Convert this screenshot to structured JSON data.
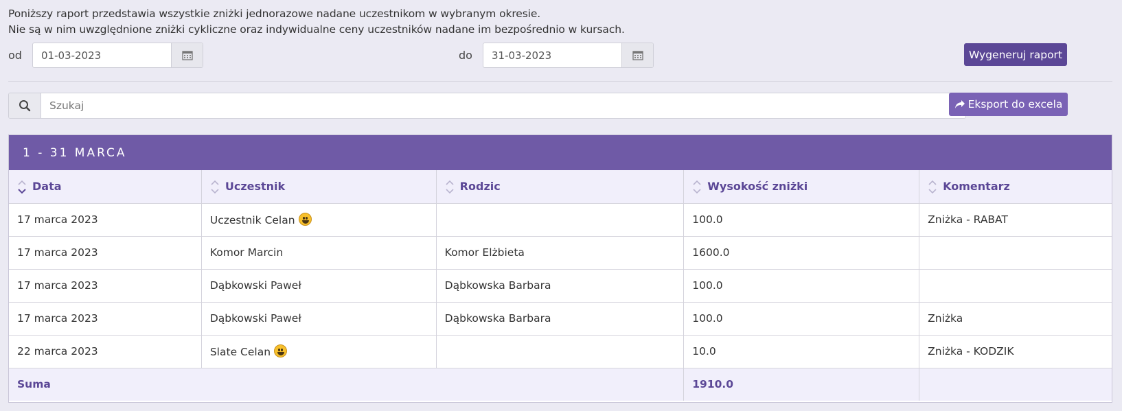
{
  "intro": {
    "line1": "Poniższy raport przedstawia wszystkie zniżki jednorazowe nadane uczestnikom w wybranym okresie.",
    "line2": "Nie są w nim uwzględnione zniżki cykliczne oraz indywidualne ceny uczestników nadane im bezpośrednio w kursach."
  },
  "filters": {
    "from_label": "od",
    "from_value": "01-03-2023",
    "to_label": "do",
    "to_value": "31-03-2023",
    "generate_label": "Wygeneruj raport"
  },
  "search": {
    "placeholder": "Szukaj",
    "export_label": "Eksport do excela"
  },
  "report": {
    "title": "1 - 31 MARCA",
    "columns": [
      "Data",
      "Uczestnik",
      "Rodzic",
      "Wysokość zniżki",
      "Komentarz"
    ],
    "rows": [
      {
        "date": "17 marca 2023",
        "participant": "Uczestnik Celan",
        "emoji": true,
        "parent": "",
        "amount": "100.0",
        "comment": "Zniżka - RABAT"
      },
      {
        "date": "17 marca 2023",
        "participant": "Komor Marcin",
        "emoji": false,
        "parent": "Komor Elżbieta",
        "amount": "1600.0",
        "comment": ""
      },
      {
        "date": "17 marca 2023",
        "participant": "Dąbkowski Paweł",
        "emoji": false,
        "parent": "Dąbkowska Barbara",
        "amount": "100.0",
        "comment": ""
      },
      {
        "date": "17 marca 2023",
        "participant": "Dąbkowski Paweł",
        "emoji": false,
        "parent": "Dąbkowska Barbara",
        "amount": "100.0",
        "comment": "Zniżka"
      },
      {
        "date": "22 marca 2023",
        "participant": "Slate Celan",
        "emoji": true,
        "parent": "",
        "amount": "10.0",
        "comment": "Zniżka - KODZIK"
      }
    ],
    "footer": {
      "label": "Suma",
      "total": "1910.0"
    }
  },
  "colors": {
    "header": "#6f5aa6",
    "primary_button": "#5b4796",
    "export_button": "#7a62b5",
    "accent_text": "#5b4796"
  },
  "icons": [
    "calendar-icon",
    "search-icon",
    "share-icon",
    "sort-icon",
    "smiley-emoji-icon"
  ]
}
